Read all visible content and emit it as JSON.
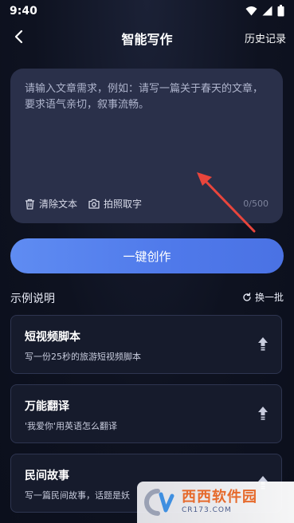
{
  "status_bar": {
    "time": "9:40",
    "icons": [
      "wifi-icon",
      "signal-icon",
      "battery-icon"
    ]
  },
  "nav": {
    "title": "智能写作",
    "history_label": "历史记录",
    "back_icon": "chevron-left-icon"
  },
  "editor": {
    "placeholder": "请输入文章需求，例如：请写一篇关于春天的文章，要求语气亲切，叙事流畅。",
    "clear_label": "清除文本",
    "photo_label": "拍照取字",
    "char_count": "0/500"
  },
  "create_button_label": "一键创作",
  "examples": {
    "section_title": "示例说明",
    "refresh_label": "换一批",
    "items": [
      {
        "title": "短视频脚本",
        "desc": "写一份25秒的旅游短视频脚本"
      },
      {
        "title": "万能翻译",
        "desc": "'我爱你'用英语怎么翻译"
      },
      {
        "title": "民间故事",
        "desc": "写一篇民间故事，话题是妖"
      }
    ]
  },
  "watermark": {
    "main": "西西软件园",
    "sub": "CR173.COM"
  },
  "colors": {
    "background": "#0e1220",
    "card": "#2a304a",
    "accent": "#5f8cf2",
    "arrow": "#e8453c"
  }
}
